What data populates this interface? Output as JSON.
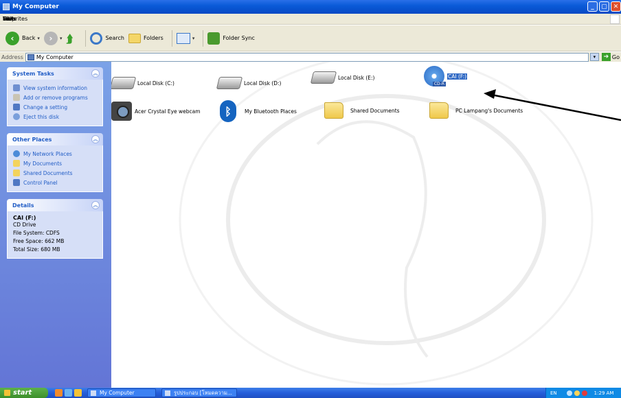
{
  "window": {
    "title": "My Computer"
  },
  "menu": [
    "File",
    "Edit",
    "View",
    "Favorites",
    "Tools",
    "Help"
  ],
  "toolbar": {
    "back_label": "Back",
    "search_label": "Search",
    "folders_label": "Folders",
    "folder_sync_label": "Folder Sync"
  },
  "address": {
    "label": "Address",
    "value": "My Computer",
    "go_label": "Go"
  },
  "sidebar": {
    "system_tasks": {
      "title": "System Tasks",
      "items": [
        "View system information",
        "Add or remove programs",
        "Change a setting",
        "Eject this disk"
      ]
    },
    "other_places": {
      "title": "Other Places",
      "items": [
        "My Network Places",
        "My Documents",
        "Shared Documents",
        "Control Panel"
      ]
    },
    "details": {
      "title": "Details",
      "name": "CAI (F:)",
      "lines": [
        "CD Drive",
        "File System: CDFS",
        "Free Space: 662 MB",
        "Total Size: 680 MB"
      ]
    }
  },
  "items": [
    {
      "label": "Local Disk (C:)",
      "icon": "hard-disk-icon"
    },
    {
      "label": "Local Disk (D:)",
      "icon": "hard-disk-icon"
    },
    {
      "label": "Local Disk (E:)",
      "icon": "hard-disk-icon"
    },
    {
      "label": "CAI (F:)",
      "icon": "cd-drive-icon",
      "badge": "CD-R",
      "selected": true
    },
    {
      "label": "Acer Crystal Eye webcam",
      "icon": "webcam-icon"
    },
    {
      "label": "My Bluetooth Places",
      "icon": "bluetooth-icon"
    },
    {
      "label": "Shared Documents",
      "icon": "folder-icon"
    },
    {
      "label": "PC Lampang's Documents",
      "icon": "folder-icon"
    }
  ],
  "taskbar": {
    "start_label": "start",
    "tasks": [
      "My Computer",
      "รูปประกอบ [โหมดความ..."
    ],
    "tray": {
      "lang": "EN",
      "time": "1:29 AM"
    }
  }
}
